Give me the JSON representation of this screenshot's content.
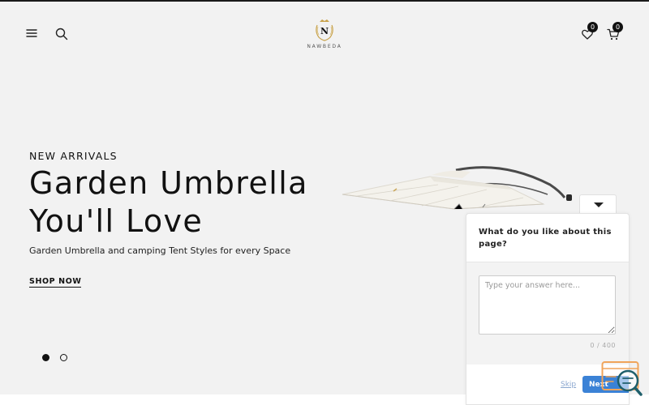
{
  "header": {
    "brand_name": "NAWBEDA",
    "brand_initial": "N",
    "wishlist_count": "0",
    "cart_count": "0",
    "icons": [
      "menu-icon",
      "search-icon",
      "heart-icon",
      "cart-icon"
    ]
  },
  "hero": {
    "eyebrow": "NEW ARRIVALS",
    "title_line1": "Garden Umbrella",
    "title_line2": "You'll Love",
    "subtitle": "Garden Umbrella and camping Tent Styles for every Space",
    "cta": "SHOP NOW",
    "slides": 2,
    "active_slide": 1
  },
  "survey": {
    "question": "What do you like about this page?",
    "placeholder": "Type your answer here...",
    "counter": "0 / 400",
    "skip_label": "Skip",
    "next_label": "Next"
  },
  "colors": {
    "page_bg": "#f2f2f2",
    "text": "#111111",
    "accent_blue": "#3b82d6",
    "logo_gold": "#c8a24a",
    "widget_orange": "#f0a45a",
    "widget_teal": "#1f5f6b"
  }
}
